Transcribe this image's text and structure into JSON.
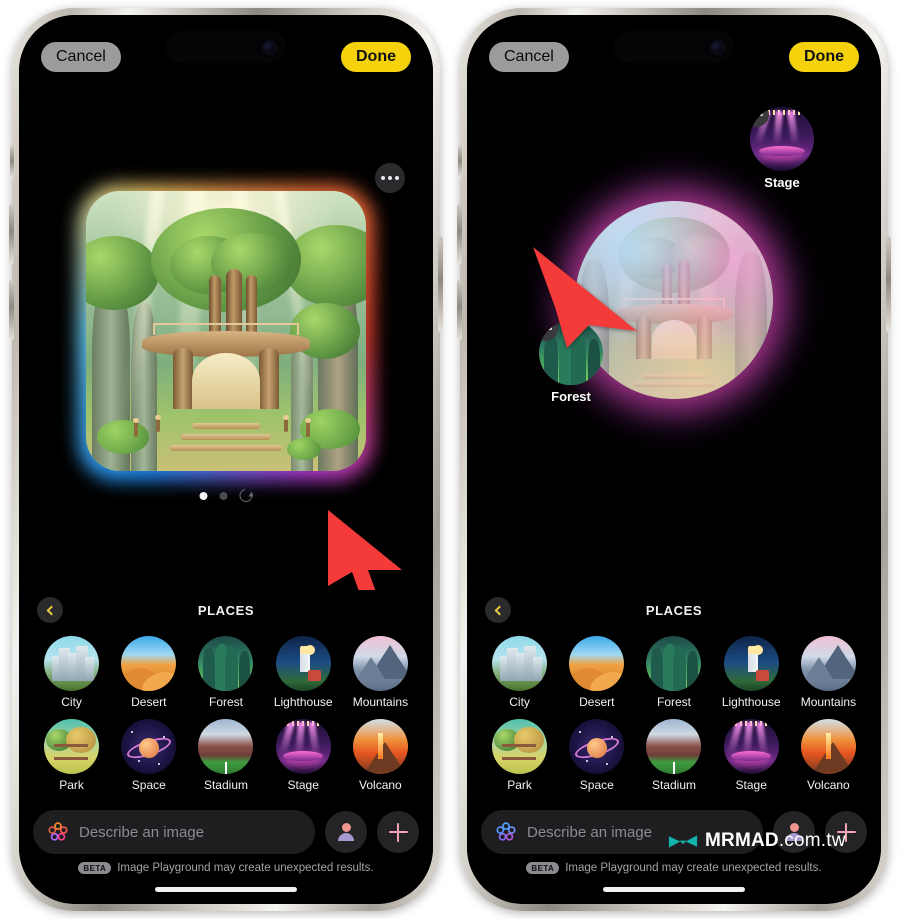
{
  "app": {
    "name": "Image Playground",
    "disclaimer": "Image Playground may create unexpected results.",
    "beta_tag": "BETA"
  },
  "topbar": {
    "cancel_label": "Cancel",
    "done_label": "Done",
    "cancel_bg": "#9b9b9e",
    "done_bg": "#f5d20c"
  },
  "picker": {
    "title": "PLACES",
    "back_icon": "chevron-left-icon",
    "back_color": "#e8c84a",
    "categories": [
      {
        "label": "City",
        "theme": "th-city"
      },
      {
        "label": "Desert",
        "theme": "th-desert"
      },
      {
        "label": "Forest",
        "theme": "th-forest"
      },
      {
        "label": "Lighthouse",
        "theme": "th-light"
      },
      {
        "label": "Mountains",
        "theme": "th-mount"
      },
      {
        "label": "Park",
        "theme": "th-park"
      },
      {
        "label": "Space",
        "theme": "th-space"
      },
      {
        "label": "Stadium",
        "theme": "th-stadium"
      },
      {
        "label": "Stage",
        "theme": "th-stage"
      },
      {
        "label": "Volcano",
        "theme": "th-volcano"
      }
    ]
  },
  "composer": {
    "placeholder": "Describe an image",
    "value": "",
    "sparkle_icon": "sparkle-icon",
    "person_icon": "person-icon",
    "plus_icon": "plus-icon",
    "sparkle_colors_left": [
      "#ff8a2b",
      "#ff3d8b",
      "#b46bff"
    ],
    "sparkle_colors_right": [
      "#4da3ff",
      "#7a6bff",
      "#c05bd8"
    ]
  },
  "left_phone": {
    "more_icon": "ellipsis-icon",
    "page_indicator": {
      "total": 2,
      "active": 1,
      "refresh_icon": "refresh-icon"
    },
    "artwork_alt": "Treehouse in a sunlit forest"
  },
  "right_phone": {
    "state": "generating",
    "orb_alt": "Treehouse preview inside an iridescent generating orb",
    "selected_chips": [
      {
        "label": "Stage",
        "theme": "th-stage",
        "remove_icon": "minus-badge-icon"
      },
      {
        "label": "Forest",
        "theme": "th-forest",
        "remove_icon": "minus-badge-icon"
      }
    ]
  },
  "cursors": [
    {
      "name": "left-canvas-cursor",
      "color": "#f53a3a"
    },
    {
      "name": "right-canvas-cursor",
      "color": "#f53a3a"
    }
  ],
  "watermark": {
    "brand": "MRMAD",
    "suffix": ".com.tw",
    "logo_icon": "mrmad-bowtie-logo-icon",
    "logo_color": "#12b2ad"
  }
}
